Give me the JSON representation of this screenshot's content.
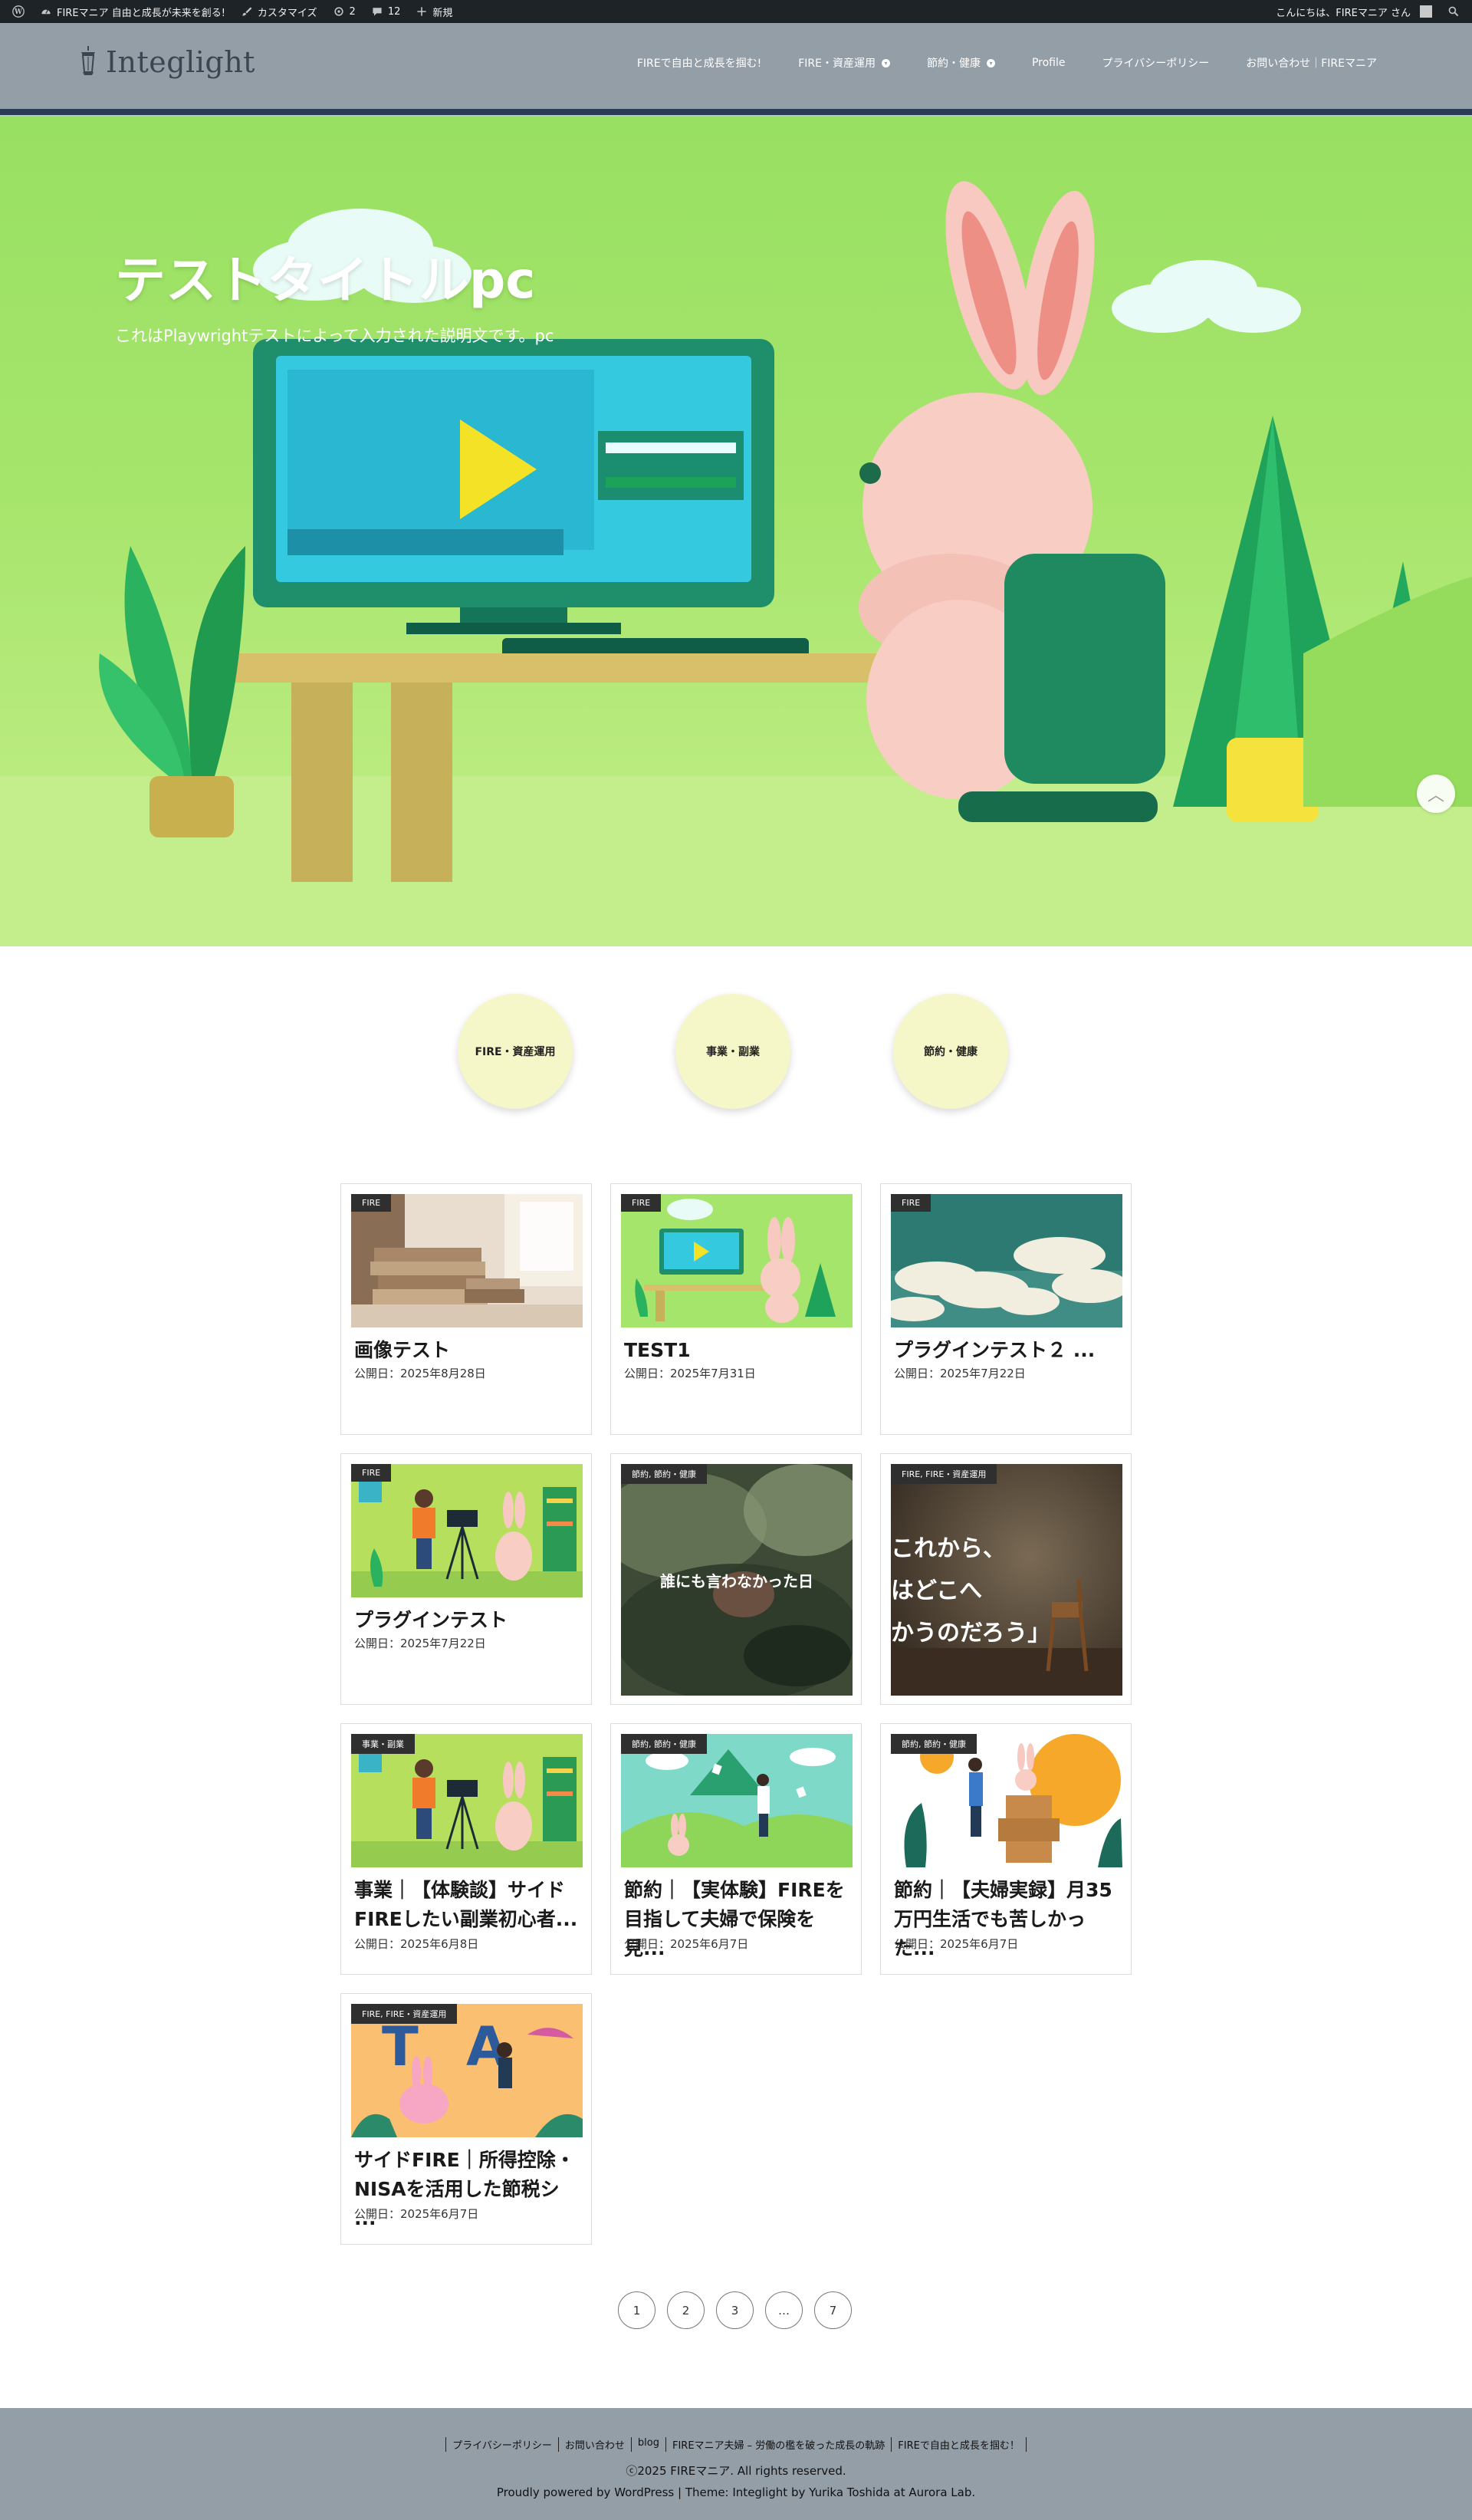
{
  "admin_bar": {
    "site_name": "FIREマニア 自由と成長が未来を創る!",
    "customize": "カスタマイズ",
    "updates_count": "2",
    "comments_count": "12",
    "new_label": "新規",
    "greeting": "こんにちは、FIREマニア さん"
  },
  "header": {
    "logo_text": "Integlight",
    "nav": [
      {
        "label": "FIREで自由と成長を掴む!",
        "has_submenu": false
      },
      {
        "label": "FIRE・資産運用",
        "has_submenu": true
      },
      {
        "label": "節約・健康",
        "has_submenu": true
      },
      {
        "label": "Profile",
        "has_submenu": false
      },
      {
        "label": "プライバシーポリシー",
        "has_submenu": false
      },
      {
        "label": "お問い合わせ｜FIREマニア",
        "has_submenu": false
      }
    ]
  },
  "hero": {
    "title": "テストタイトルpc",
    "description": "これはPlaywrightテストによって入力された説明文です。pc"
  },
  "categories": [
    "FIRE・資産運用",
    "事業・副業",
    "節約・健康"
  ],
  "posts": [
    {
      "tag": "FIRE",
      "title": "画像テスト",
      "date": "公開日：2025年8月28日",
      "thumb": "books"
    },
    {
      "tag": "FIRE",
      "title": "TEST1",
      "date": "公開日：2025年7月31日",
      "thumb": "rabbit-pc"
    },
    {
      "tag": "FIRE",
      "title": "プラグインテスト２ ...",
      "date": "公開日：2025年7月22日",
      "thumb": "clouds"
    },
    {
      "tag": "FIRE",
      "title": "プラグインテスト",
      "date": "公開日：2025年7月22日",
      "thumb": "camera"
    },
    {
      "tag": "節約, 節約・健康",
      "title": "",
      "date": "",
      "thumb": "forest",
      "image_text": "誰にも言わなかった日"
    },
    {
      "tag": "FIRE, FIRE・資産運用",
      "title": "",
      "date": "",
      "thumb": "room",
      "image_text": "これから、\n私はどこへ\n向かうのだろう」"
    },
    {
      "tag": "事業・副業",
      "title": "事業｜【体験談】サイドFIREしたい副業初心者...",
      "date": "公開日：2025年6月8日",
      "thumb": "camera"
    },
    {
      "tag": "節約, 節約・健康",
      "title": "節約｜【実体験】FIREを目指して夫婦で保険を見...",
      "date": "公開日：2025年6月7日",
      "thumb": "field"
    },
    {
      "tag": "節約, 節約・健康",
      "title": "節約｜【夫婦実録】月35万円生活でも苦しかった...",
      "date": "公開日：2025年6月7日",
      "thumb": "boxes"
    },
    {
      "tag": "FIRE, FIRE・資産運用",
      "title": "サイドFIRE｜所得控除・NISAを活用した節税シ ...",
      "date": "公開日：2025年6月7日",
      "thumb": "tax"
    }
  ],
  "pagination": [
    "1",
    "2",
    "3",
    "…",
    "7"
  ],
  "footer": {
    "links": [
      "プライバシーポリシー",
      "お問い合わせ",
      "blog",
      "FIREマニア夫婦 – 労働の檻を破った成長の軌跡",
      "FIREで自由と成長を掴む！"
    ],
    "copyright": "ⓒ2025 FIREマニア. All rights reserved.",
    "powered": "Proudly powered by WordPress | Theme: Integlight by Yurika Toshida at Aurora Lab."
  },
  "colors": {
    "header_bg": "#949ea7",
    "admin_bar_bg": "#1d2327",
    "accent_bar": "#2b3a55",
    "category_circle": "#f5f7c9",
    "tag_bg": "#2f2f2f"
  }
}
